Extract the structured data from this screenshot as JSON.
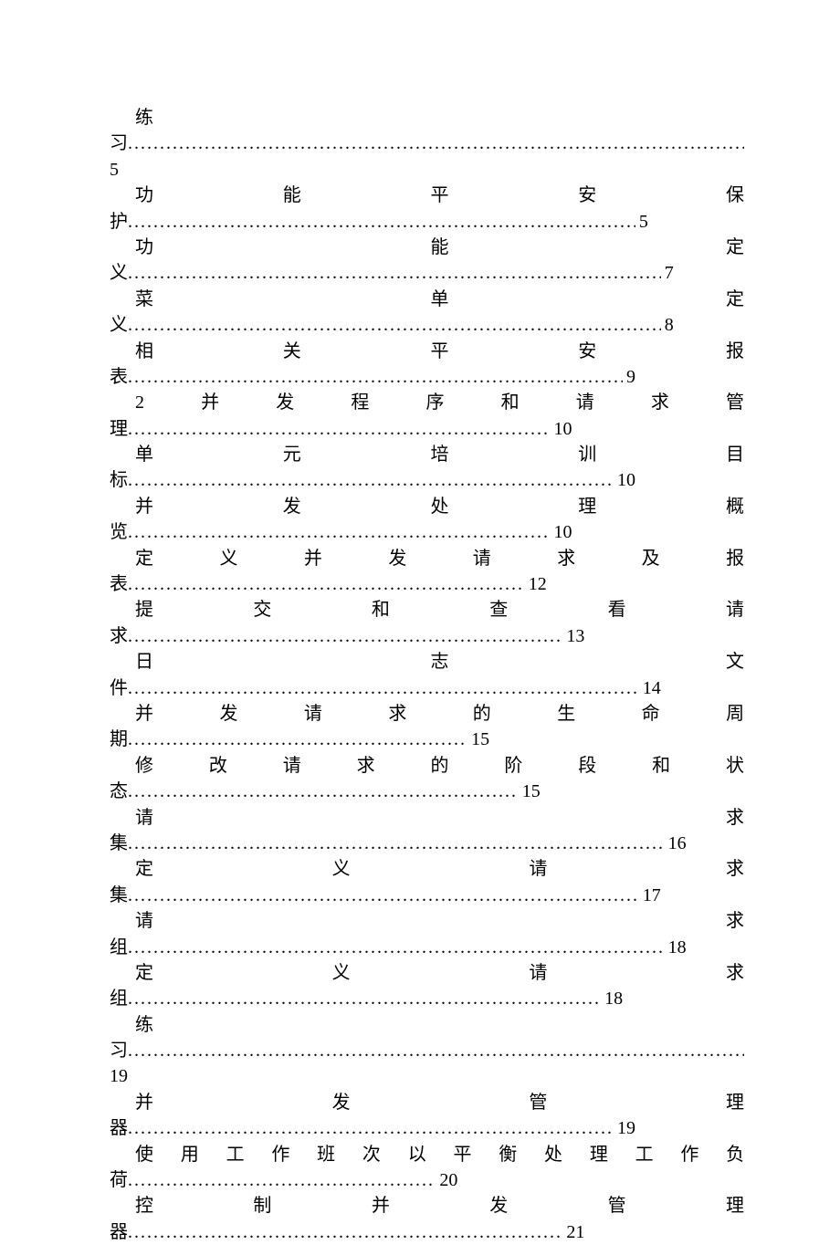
{
  "dots": "..............................................................................................................................................................................................",
  "toc": [
    {
      "title_chars": [
        "练"
      ],
      "tail": "习",
      "page": "5",
      "inline_page": false,
      "leader_width_pct": 100
    },
    {
      "title_chars": [
        "功",
        "能",
        "平",
        "安",
        "保"
      ],
      "tail": "护",
      "page": "5",
      "inline_page": true,
      "leader_width_pct": 82
    },
    {
      "title_chars": [
        "功",
        "能",
        "定"
      ],
      "tail": "义",
      "page": "7",
      "inline_page": true,
      "leader_width_pct": 86
    },
    {
      "title_chars": [
        "菜",
        "单",
        "定"
      ],
      "tail": "义",
      "page": "8",
      "inline_page": true,
      "leader_width_pct": 86
    },
    {
      "title_chars": [
        "相",
        "关",
        "平",
        "安",
        "报"
      ],
      "tail": "表",
      "page": "9",
      "inline_page": true,
      "leader_width_pct": 80
    },
    {
      "title_chars": [
        "2",
        "并",
        "发",
        "程",
        "序",
        "和",
        "请",
        "求",
        "管"
      ],
      "tail": "理",
      "page": "10",
      "inline_page": true,
      "leader_width_pct": 70
    },
    {
      "title_chars": [
        "单",
        "元",
        "培",
        "训",
        "目"
      ],
      "tail": "标",
      "page": "10",
      "inline_page": true,
      "leader_width_pct": 80
    },
    {
      "title_chars": [
        "并",
        "发",
        "处",
        "理",
        "概"
      ],
      "tail": "览",
      "page": "10",
      "inline_page": true,
      "leader_width_pct": 70
    },
    {
      "title_chars": [
        "定",
        "义",
        "并",
        "发",
        "请",
        "求",
        "及",
        "报"
      ],
      "tail": "表",
      "page": "12",
      "inline_page": true,
      "leader_width_pct": 66
    },
    {
      "title_chars": [
        "提",
        "交",
        "和",
        "查",
        "看",
        "请"
      ],
      "tail": "求",
      "page": "13",
      "inline_page": true,
      "leader_width_pct": 72
    },
    {
      "title_chars": [
        "日",
        "志",
        "文"
      ],
      "tail": "件",
      "page": "14",
      "inline_page": true,
      "leader_width_pct": 84
    },
    {
      "title_chars": [
        "并",
        "发",
        "请",
        "求",
        "的",
        "生",
        "命",
        "周"
      ],
      "tail": "期",
      "page": "15",
      "inline_page": true,
      "leader_width_pct": 57
    },
    {
      "title_chars": [
        "修",
        "改",
        "请",
        "求",
        "的",
        "阶",
        "段",
        "和",
        "状"
      ],
      "tail": "态",
      "page": "15",
      "inline_page": true,
      "leader_width_pct": 65
    },
    {
      "title_chars": [
        "请",
        "求"
      ],
      "tail": "集",
      "page": "16",
      "inline_page": true,
      "leader_width_pct": 88
    },
    {
      "title_chars": [
        "定",
        "义",
        "请",
        "求"
      ],
      "tail": "集",
      "page": "17",
      "inline_page": true,
      "leader_width_pct": 84
    },
    {
      "title_chars": [
        "请",
        "求"
      ],
      "tail": "组",
      "page": "18",
      "inline_page": true,
      "leader_width_pct": 88
    },
    {
      "title_chars": [
        "定",
        "义",
        "请",
        "求"
      ],
      "tail": "组",
      "page": "18",
      "inline_page": true,
      "leader_width_pct": 78
    },
    {
      "title_chars": [
        "练"
      ],
      "tail": "习",
      "page": "19",
      "inline_page": false,
      "leader_width_pct": 100
    },
    {
      "title_chars": [
        "并",
        "发",
        "管",
        "理"
      ],
      "tail": "器",
      "page": "19",
      "inline_page": true,
      "leader_width_pct": 80
    },
    {
      "title_chars": [
        "使",
        "用",
        "工",
        "作",
        "班",
        "次",
        "以",
        "平",
        "衡",
        "处",
        "理",
        "工",
        "作",
        "负"
      ],
      "tail": "荷",
      "page": "20",
      "inline_page": true,
      "leader_width_pct": 52
    },
    {
      "title_chars": [
        "控",
        "制",
        "并",
        "发",
        "管",
        "理"
      ],
      "tail": "器",
      "page": "21",
      "inline_page": true,
      "leader_width_pct": 72
    }
  ]
}
